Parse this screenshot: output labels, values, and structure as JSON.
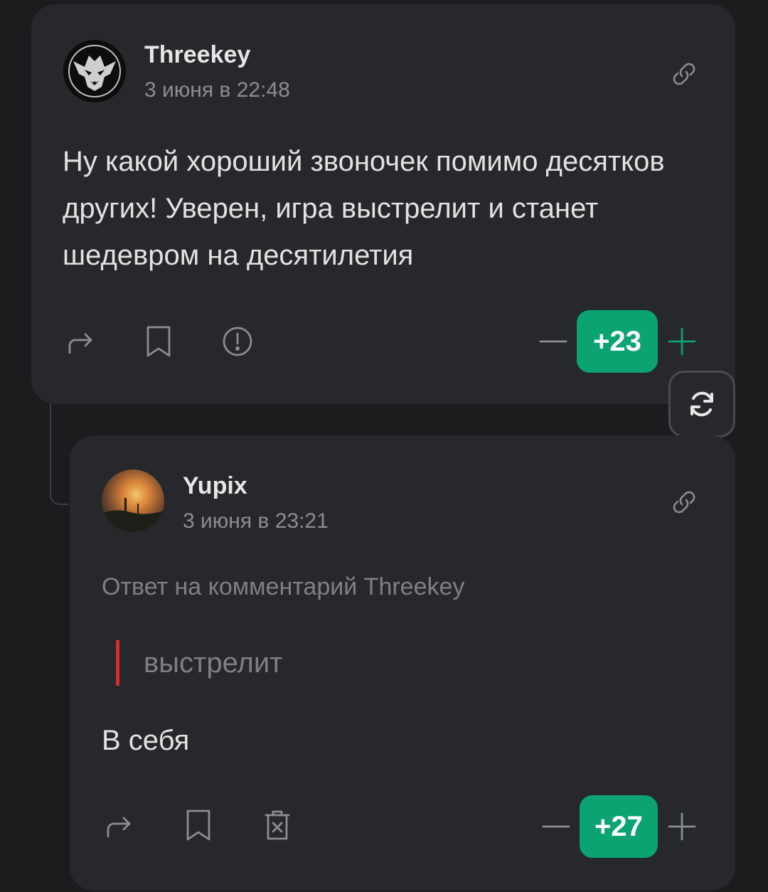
{
  "comments": [
    {
      "author": "Threekey",
      "date": "3 июня в 22:48",
      "avatar_icon": "wolf-medallion-avatar",
      "text": "Ну какой хороший звоночек помимо десятков других! Уверен, игра выстрелит и станет шедевром на десятилетия",
      "score": "+23",
      "actions": [
        "share-icon",
        "bookmark-icon",
        "report-icon"
      ]
    },
    {
      "author": "Yupix",
      "date": "3 июня в 23:21",
      "avatar_icon": "sunset-photo-avatar",
      "reply_to": "Ответ на комментарий Threekey",
      "quote": "выстрелит",
      "text": "В себя",
      "score": "+27",
      "actions": [
        "share-icon",
        "bookmark-icon",
        "delete-icon"
      ]
    }
  ],
  "colors": {
    "background": "#1b1c1e",
    "card": "#27282b",
    "accent_green": "#0aa371",
    "quote_red": "#d62d30",
    "muted_text": "#8c8d90"
  },
  "refresh_icon": "refresh-icon"
}
